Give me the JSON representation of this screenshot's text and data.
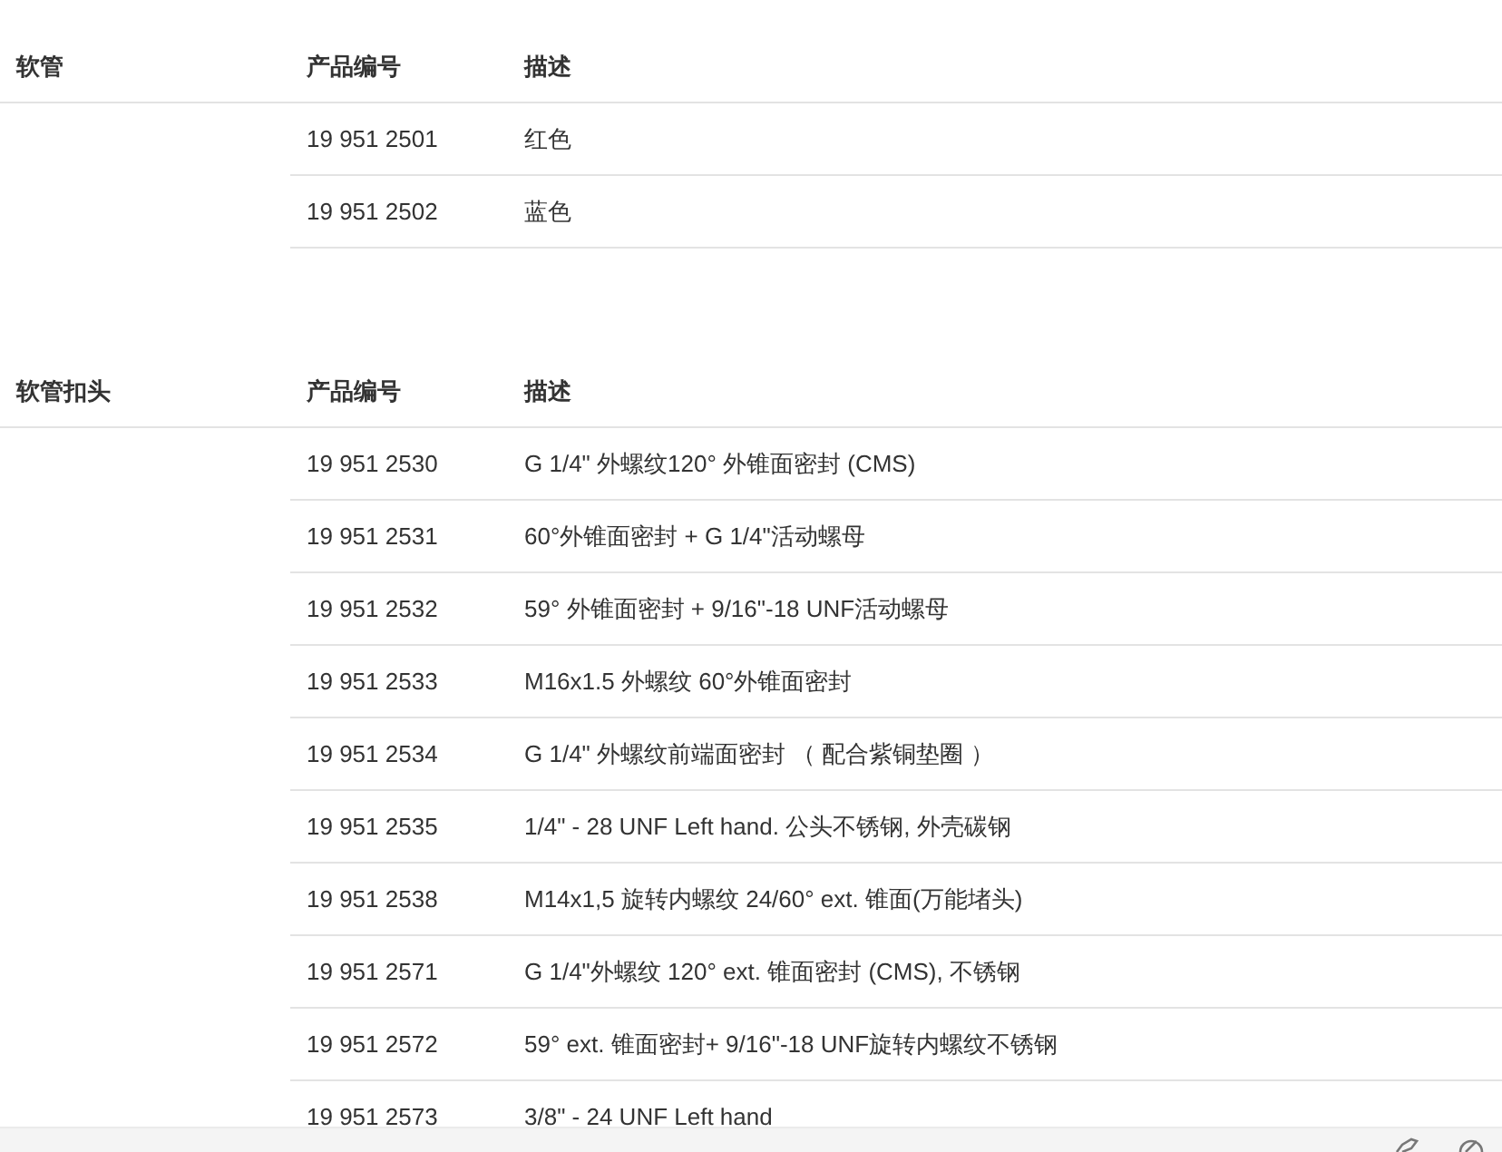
{
  "sections": [
    {
      "title": "软管",
      "columns": [
        "产品编号",
        "描述"
      ],
      "rows": [
        {
          "code": "19 951 2501",
          "description": "红色"
        },
        {
          "code": "19 951 2502",
          "description": "蓝色"
        }
      ]
    },
    {
      "title": "软管扣头",
      "columns": [
        "产品编号",
        "描述"
      ],
      "rows": [
        {
          "code": "19 951 2530",
          "description": "G 1/4\" 外螺纹120° 外锥面密封 (CMS)"
        },
        {
          "code": "19 951 2531",
          "description": "60°外锥面密封 + G 1/4\"活动螺母"
        },
        {
          "code": "19 951 2532",
          "description": "59° 外锥面密封 + 9/16\"-18 UNF活动螺母"
        },
        {
          "code": "19 951 2533",
          "description": "M16x1.5 外螺纹 60°外锥面密封"
        },
        {
          "code": "19 951 2534",
          "description": "G 1/4\" 外螺纹前端面密封 （ 配合紫铜垫圈 ）"
        },
        {
          "code": "19 951 2535",
          "description": "1/4\" - 28 UNF Left hand. 公头不锈钢, 外壳碳钢"
        },
        {
          "code": "19 951 2538",
          "description": "M14x1,5 旋转内螺纹 24/60° ext. 锥面(万能堵头)"
        },
        {
          "code": "19 951 2571",
          "description": "G 1/4\"外螺纹 120° ext. 锥面密封 (CMS), 不锈钢"
        },
        {
          "code": "19 951 2572",
          "description": "59° ext. 锥面密封+ 9/16\"-18 UNF旋转内螺纹不锈钢"
        },
        {
          "code": "19 951 2573",
          "description": "3/8\" - 24 UNF Left hand"
        }
      ]
    }
  ]
}
